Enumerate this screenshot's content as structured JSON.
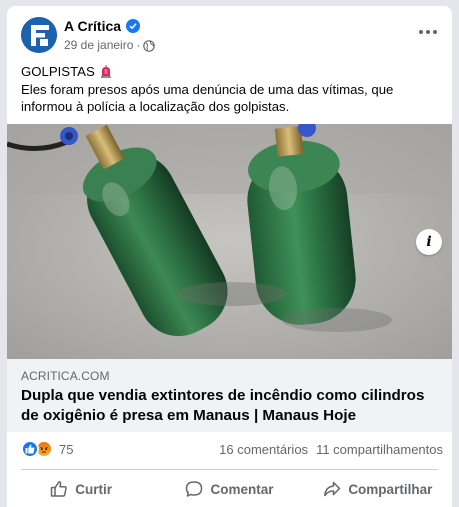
{
  "post": {
    "page_name": "A Crítica",
    "date": "29 de janeiro",
    "separator": "·",
    "heading": "GOLPISTAS",
    "text": "Eles foram presos após uma denúncia de uma das vítimas, que informou à polícia a localização dos golpistas."
  },
  "link": {
    "domain": "ACRITICA.COM",
    "title": "Dupla que vendia extintores de incêndio como cilindros de oxigênio é presa em Manaus | Manaus Hoje"
  },
  "stats": {
    "reaction_count": "75",
    "comments": "16 comentários",
    "shares": "11 compartilhamentos"
  },
  "actions": {
    "like": "Curtir",
    "comment": "Comentar",
    "share": "Compartilhar"
  },
  "colors": {
    "brand_blue": "#1877f2",
    "avatar_blue": "#1c62ad",
    "muted_text": "#65676b"
  },
  "icons": {
    "verified": "verified-badge-icon",
    "audience": "globe-icon",
    "heading_emoji": "police-siren-icon",
    "info": "info-icon",
    "like": "thumbs-up-icon",
    "comment": "speech-bubble-icon",
    "share": "share-arrow-icon"
  }
}
